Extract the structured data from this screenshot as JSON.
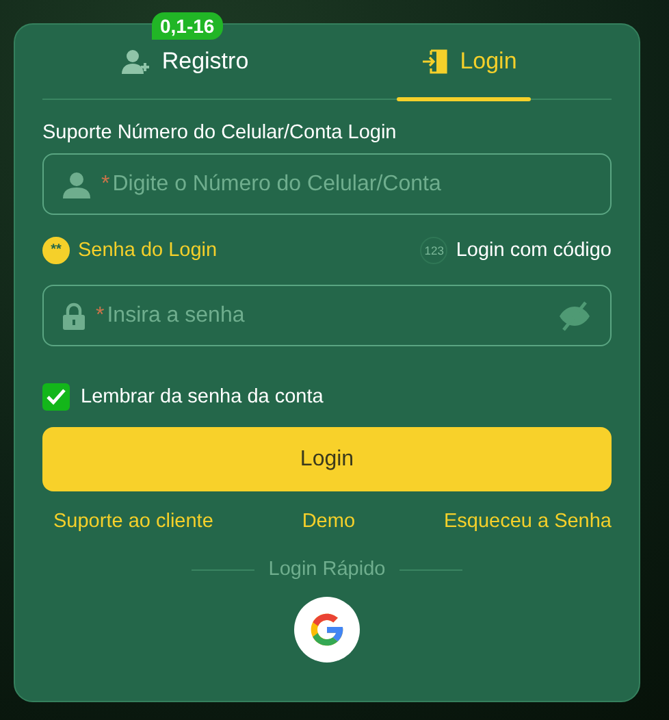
{
  "tabs": [
    {
      "kind": "register",
      "label": "Registro",
      "selected": false,
      "badge": "0,1-16"
    },
    {
      "kind": "login",
      "label": "Login",
      "selected": true
    }
  ],
  "account": {
    "label": "Suporte Número do Celular/Conta Login",
    "field": {
      "kind": "user",
      "required_mark": "*",
      "placeholder": "Digite o Número do Celular/Conta"
    }
  },
  "modes": [
    {
      "kind": "password",
      "icon_text": "**",
      "label": "Senha do Login",
      "selected": true
    },
    {
      "kind": "code",
      "icon_text": "123",
      "label": "Login com código",
      "selected": false
    }
  ],
  "password": {
    "kind": "lock",
    "required_mark": "*",
    "placeholder": "Insira a senha",
    "revealed": false
  },
  "remember": {
    "label": "Lembrar da senha da conta",
    "checked": true
  },
  "submit": "Login",
  "links": [
    "Suporte ao cliente",
    "Demo",
    "Esqueceu a Senha"
  ],
  "quick_login": {
    "label": "Login Rápido",
    "providers": [
      {
        "kind": "google"
      }
    ]
  }
}
